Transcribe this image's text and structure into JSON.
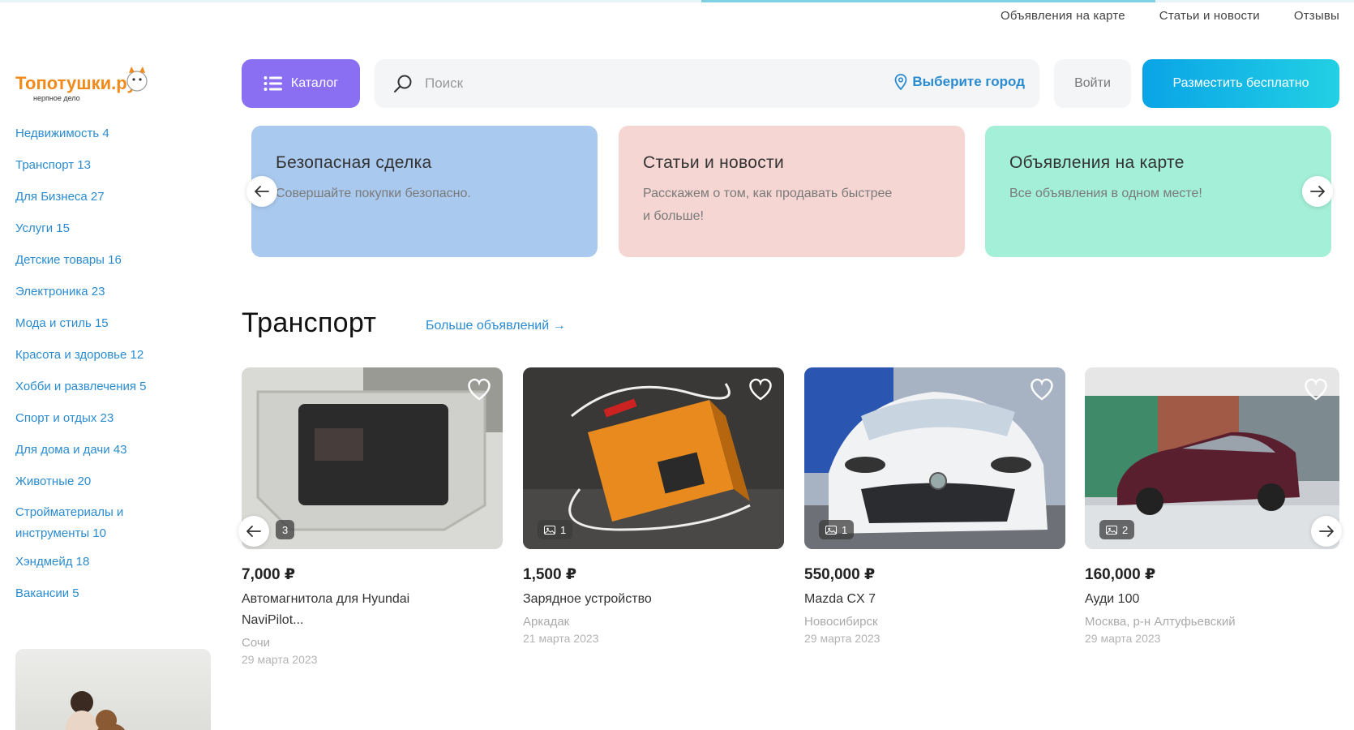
{
  "topnav": {
    "items": [
      "Объявления на карте",
      "Статьи и новости",
      "Отзывы"
    ]
  },
  "logo": {
    "text": "Топотушки.ру",
    "subtitle": "нерпное дело"
  },
  "sidebar": {
    "items": [
      {
        "label": "Недвижимость 4"
      },
      {
        "label": "Транспорт 13"
      },
      {
        "label": "Для Бизнеса 27"
      },
      {
        "label": "Услуги 15"
      },
      {
        "label": "Детские товары 16"
      },
      {
        "label": "Электроника 23"
      },
      {
        "label": "Мода и стиль 15"
      },
      {
        "label": "Красота и здоровье 12"
      },
      {
        "label": "Хобби и развлечения 5"
      },
      {
        "label": "Спорт и отдых 23"
      },
      {
        "label": "Для дома и дачи 43"
      },
      {
        "label": "Животные 20"
      },
      {
        "label": "Стройматериалы и инструменты 10"
      },
      {
        "label": "Хэндмейд 18"
      },
      {
        "label": "Вакансии 5"
      }
    ]
  },
  "header": {
    "catalog_label": "Каталог",
    "search_placeholder": "Поиск",
    "city_label": "Выберите город",
    "login_label": "Войти",
    "post_label": "Разместить бесплатно"
  },
  "promos": [
    {
      "title": "Безопасная сделка",
      "text": "Совершайте покупки безопасно.",
      "color": "#a9c9ee"
    },
    {
      "title": "Статьи и новости",
      "text": "Расскажем о том, как продавать быстрее и больше!",
      "color": "#f5d6d2"
    },
    {
      "title": "Объявления на карте",
      "text": "Все объявления в одном месте!",
      "color": "#a4efd7"
    }
  ],
  "section": {
    "title": "Транспорт",
    "more_label": "Больше объявлений →"
  },
  "listings": [
    {
      "price": "7,000 ₽",
      "title": "Автомагнитола для Hyundai NaviPilot...",
      "location": "Сочи",
      "date": "29 марта 2023",
      "photos": "3"
    },
    {
      "price": "1,500 ₽",
      "title": "Зарядное устройство",
      "location": "Аркадак",
      "date": "21 марта 2023",
      "photos": "1"
    },
    {
      "price": "550,000 ₽",
      "title": "Mazda CX 7",
      "location": "Новосибирск",
      "date": "29 марта 2023",
      "photos": "1"
    },
    {
      "price": "160,000 ₽",
      "title": "Ауди 100",
      "location": "Москва, р-н Алтуфьевский",
      "date": "29 марта 2023",
      "photos": "2"
    }
  ],
  "colors": {
    "accent_purple": "#8a6ff2",
    "accent_blue": "#2a8bd0",
    "post_gradient_start": "#0aa4e6",
    "post_gradient_end": "#22d0e4"
  }
}
